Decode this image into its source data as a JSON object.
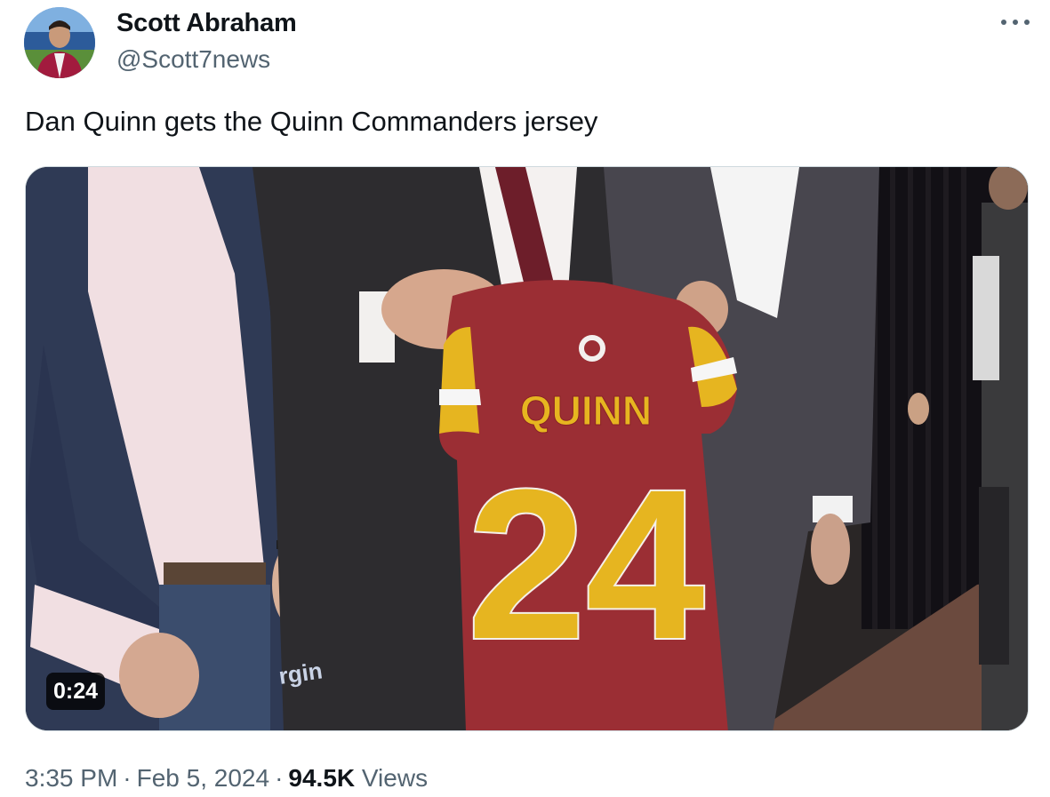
{
  "author": {
    "name": "Scott Abraham",
    "handle": "@Scott7news"
  },
  "tweet": {
    "text": "Dan Quinn gets the Quinn Commanders jersey"
  },
  "media": {
    "type": "video",
    "duration": "0:24",
    "jersey_name": "QUINN",
    "jersey_number": "24",
    "backdrop_text": "rgin"
  },
  "meta": {
    "time": "3:35 PM",
    "separator": "·",
    "date": "Feb 5, 2024",
    "views_count": "94.5K",
    "views_label": "Views"
  },
  "colors": {
    "jersey_burgundy": "#9b2e34",
    "jersey_gold": "#e6b520",
    "secondary_text": "#536471"
  },
  "icons": {
    "more": "more-horizontal-icon"
  }
}
